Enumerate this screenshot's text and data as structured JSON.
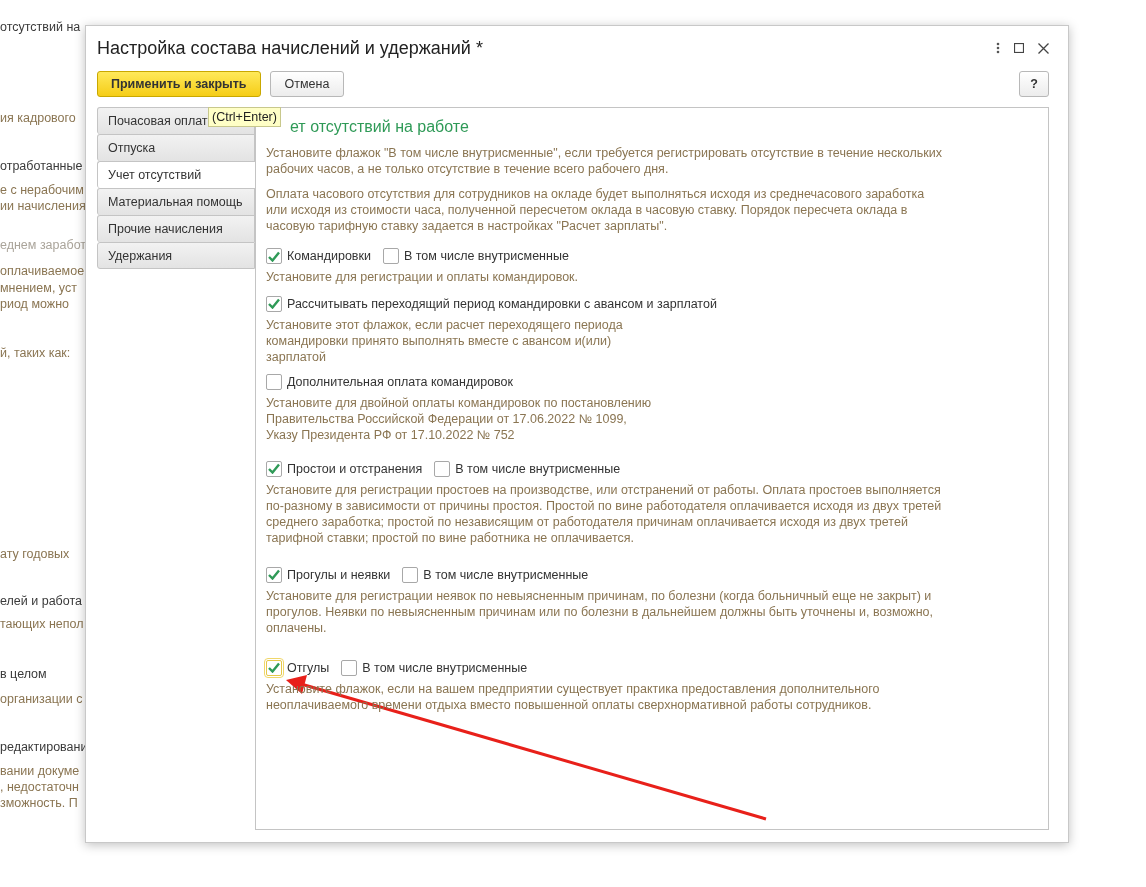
{
  "background_lines": [
    {
      "text": "отсутствий на",
      "muted": false,
      "disabled": false
    },
    {
      "text": "ия кадрового",
      "muted": true,
      "disabled": false
    },
    {
      "text": "отработанные",
      "muted": false,
      "disabled": false
    },
    {
      "text": "е с нерабочим",
      "muted": true,
      "disabled": false
    },
    {
      "text": "ии начисления",
      "muted": true,
      "disabled": false
    },
    {
      "text": "еднем заработ",
      "muted": true,
      "disabled": true
    },
    {
      "text": "оплачиваемое",
      "muted": true,
      "disabled": false
    },
    {
      "text": "мнением, уст",
      "muted": true,
      "disabled": false
    },
    {
      "text": "риод можно",
      "muted": true,
      "disabled": false
    },
    {
      "text": "й, таких как:",
      "muted": true,
      "disabled": false
    },
    {
      "text": "ату годовых",
      "muted": true,
      "disabled": false
    },
    {
      "text": "елей и работа",
      "muted": false,
      "disabled": false
    },
    {
      "text": "тающих непол",
      "muted": true,
      "disabled": false
    },
    {
      "text": "в целом",
      "muted": false,
      "disabled": false
    },
    {
      "text": "организации с",
      "muted": true,
      "disabled": false
    },
    {
      "text": "редактировани",
      "muted": false,
      "disabled": false
    },
    {
      "text": "вании докуме",
      "muted": true,
      "disabled": false
    },
    {
      "text": ", недостаточн",
      "muted": true,
      "disabled": false
    },
    {
      "text": "зможность. П",
      "muted": true,
      "disabled": false
    }
  ],
  "dialog": {
    "title": "Настройка состава начислений и удержаний *",
    "toolbar": {
      "primary": "Применить и закрыть",
      "cancel": "Отмена",
      "help": "?"
    },
    "tooltip": "(Ctrl+Enter)",
    "tabs": [
      {
        "label": "Почасовая оплат",
        "selected": false
      },
      {
        "label": "Отпуска",
        "selected": false
      },
      {
        "label": "Учет отсутствий",
        "selected": true
      },
      {
        "label": "Материальная помощь",
        "selected": false
      },
      {
        "label": "Прочие начисления",
        "selected": false
      },
      {
        "label": "Удержания",
        "selected": false
      }
    ],
    "section": {
      "heading": "ет отсутствий на работе",
      "intro": [
        [
          "Установите флажок \"В том числе внутрисменные\", если требуется регистрировать отсутствие в течение нескольких",
          "рабочих часов, а не только отсутствие в течение всего рабочего дня."
        ],
        [
          "Оплата часового отсутствия для сотрудников на окладе будет выполняться исходя из среднечасового заработка",
          "или исходя из стоимости часа, полученной пересчетом оклада в часовую ставку. Порядок пересчета оклада в",
          "часовую тарифную ставку задается в настройках \"Расчет зарплаты\"."
        ]
      ],
      "options": [
        {
          "checkboxes": [
            {
              "label": "Командировки",
              "checked": true,
              "focused": false
            },
            {
              "label": "В том числе внутрисменные",
              "checked": false,
              "focused": false
            }
          ],
          "description": [
            "Установите для регистрации и оплаты командировок."
          ]
        },
        {
          "checkboxes": [
            {
              "label": "Рассчитывать переходящий период командировки с авансом и зарплатой",
              "checked": true,
              "focused": false
            }
          ],
          "description": [
            "Установите этот флажок, если расчет переходящего периода",
            "командировки принято выполнять вместе с авансом и(или)",
            "зарплатой"
          ]
        },
        {
          "checkboxes": [
            {
              "label": "Дополнительная оплата командировок",
              "checked": false,
              "focused": false
            }
          ],
          "description": [
            "Установите для двойной оплаты командировок по постановлению",
            "Правительства Российской Федерации от 17.06.2022 № 1099,",
            "Указу Президента РФ от 17.10.2022 № 752"
          ]
        },
        {
          "checkboxes": [
            {
              "label": "Простои и отстранения",
              "checked": true,
              "focused": false
            },
            {
              "label": "В том числе внутрисменные",
              "checked": false,
              "focused": false
            }
          ],
          "description": [
            "Установите для регистрации простоев на производстве, или отстранений от работы. Оплата простоев выполняется",
            "по-разному в зависимости от причины простоя. Простой по вине работодателя оплачивается исходя из двух третей",
            "среднего заработка; простой по независящим от работодателя причинам оплачивается исходя из двух третей",
            "тарифной ставки; простой по вине работника не оплачивается."
          ]
        },
        {
          "checkboxes": [
            {
              "label": "Прогулы и неявки",
              "checked": true,
              "focused": false
            },
            {
              "label": "В том числе внутрисменные",
              "checked": false,
              "focused": false
            }
          ],
          "description": [
            "Установите для регистрации неявок по невыясненным причинам, по болезни (когда больничный еще не закрыт) и",
            "прогулов. Неявки по невыясненным причинам или по болезни в дальнейшем должны быть уточнены и, возможно,",
            "оплачены."
          ]
        },
        {
          "checkboxes": [
            {
              "label": "Отгулы",
              "checked": true,
              "focused": true
            },
            {
              "label": "В том числе внутрисменные",
              "checked": false,
              "focused": false
            }
          ],
          "description": [
            "Установите флажок, если на вашем предприятии существует практика предоставления дополнительного",
            "неоплачиваемого времени отдыха вместо повышенной оплаты сверхнормативной работы сотрудников."
          ]
        }
      ]
    }
  },
  "annotation": {
    "kind": "arrow"
  }
}
